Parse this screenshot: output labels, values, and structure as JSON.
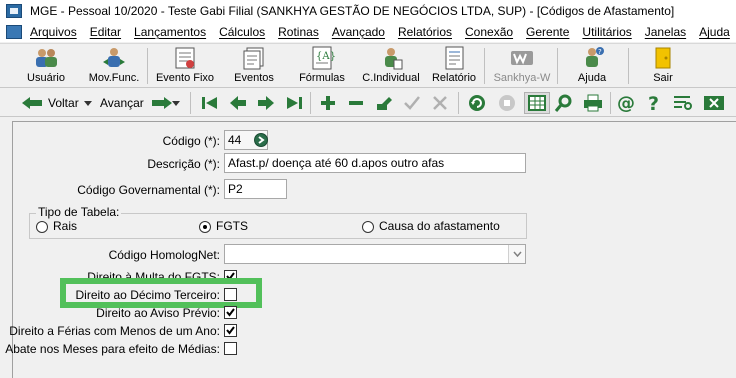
{
  "window": {
    "title": "MGE - Pessoal 10/2020 - Teste Gabi Filial (SANKHYA GESTÃO DE NEGÓCIOS LTDA, SUP) - [Códigos de Afastamento]"
  },
  "menu": [
    "Arquivos",
    "Editar",
    "Lançamentos",
    "Cálculos",
    "Rotinas",
    "Avançado",
    "Relatórios",
    "Conexão",
    "Gerente",
    "Utilitários",
    "Janelas",
    "Ajuda"
  ],
  "big_toolbar": {
    "usuario": "Usuário",
    "movfunc": "Mov.Func.",
    "evento_fixo": "Evento Fixo",
    "eventos": "Eventos",
    "formulas": "Fórmulas",
    "individual": "C.Individual",
    "relatorio": "Relatório",
    "sankhya": "Sankhya-W",
    "ajuda": "Ajuda",
    "sair": "Sair"
  },
  "nav_toolbar": {
    "voltar": "Voltar",
    "avancar": "Avançar"
  },
  "form": {
    "codigo_label": "Código (*):",
    "codigo_value": "44",
    "descricao_label": "Descrição (*):",
    "descricao_value": "Afast.p/ doença até 60 d.apos outro afas",
    "codigo_gov_label": "Código Governamental (*):",
    "codigo_gov_value": "P2",
    "tipo_tabela_title": "Tipo de Tabela:",
    "radio_rais": "Rais",
    "radio_fgts": "FGTS",
    "radio_causa": "Causa do afastamento",
    "tipo_tabela_selected": "FGTS",
    "homolognet_label": "Código HomologNet:",
    "homolognet_value": "",
    "multa_fgts_label": "Direito à Multa do FGTS:",
    "multa_fgts_checked": true,
    "decimo_label": "Direito ao Décimo Terceiro:",
    "decimo_checked": false,
    "aviso_label": "Direito ao Aviso Prévio:",
    "aviso_checked": true,
    "ferias_label": "Direito a Férias com Menos de um Ano:",
    "ferias_checked": true,
    "abate_label": "Abate nos Meses para efeito de Médias:",
    "abate_checked": false
  },
  "colors": {
    "highlight": "#52c05a",
    "toolbar_icon": "#2a7a3a"
  }
}
